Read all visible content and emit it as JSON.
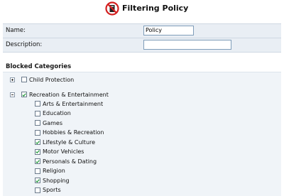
{
  "header": {
    "title": "Filtering Policy",
    "icon": "no-entry-policy-icon"
  },
  "form": {
    "name_label": "Name:",
    "name_value": "Policy",
    "description_label": "Description:",
    "description_value": ""
  },
  "blocked_categories": {
    "title": "Blocked Categories",
    "groups": [
      {
        "label": "Child Protection",
        "checked": false,
        "expanded": false
      },
      {
        "label": "Recreation & Entertainment",
        "checked": true,
        "expanded": true,
        "items": [
          {
            "label": "Arts & Entertainment",
            "checked": false
          },
          {
            "label": "Education",
            "checked": false
          },
          {
            "label": "Games",
            "checked": false
          },
          {
            "label": "Hobbies & Recreation",
            "checked": false
          },
          {
            "label": "Lifestyle & Culture",
            "checked": true
          },
          {
            "label": "Motor Vehicles",
            "checked": true
          },
          {
            "label": "Personals & Dating",
            "checked": true
          },
          {
            "label": "Religion",
            "checked": false
          },
          {
            "label": "Shopping",
            "checked": true
          },
          {
            "label": "Sports",
            "checked": false
          }
        ]
      }
    ]
  },
  "colors": {
    "panel_bg": "#f0f4f8",
    "field_bg": "#e9eef4",
    "check_green": "#1f9a3a",
    "logo_red": "#d32020"
  }
}
